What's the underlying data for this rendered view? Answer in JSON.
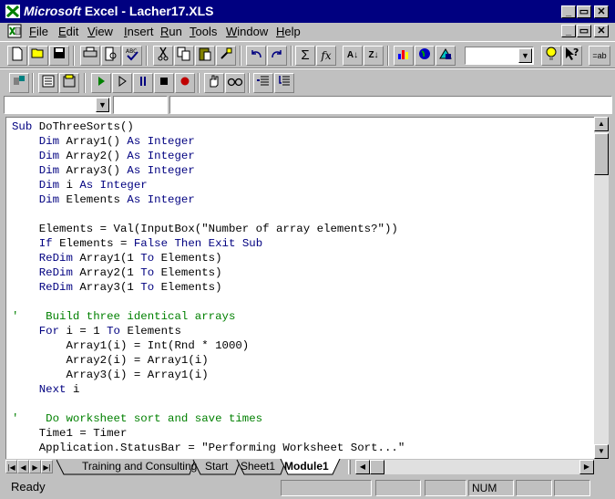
{
  "window": {
    "title_brand": "Microsoft",
    "title_rest": " Excel - Lacher17.XLS",
    "buttons": {
      "minimize": "_",
      "restore": "▭",
      "close": "✕"
    },
    "doc_buttons": {
      "minimize": "_",
      "restore": "▭",
      "close": "✕"
    }
  },
  "menubar": {
    "items": [
      {
        "pre": "",
        "ul": "F",
        "post": "ile"
      },
      {
        "pre": "",
        "ul": "E",
        "post": "dit"
      },
      {
        "pre": "",
        "ul": "V",
        "post": "iew"
      },
      {
        "pre": "",
        "ul": "I",
        "post": "nsert"
      },
      {
        "pre": "",
        "ul": "R",
        "post": "un"
      },
      {
        "pre": "",
        "ul": "T",
        "post": "ools"
      },
      {
        "pre": "",
        "ul": "W",
        "post": "indow"
      },
      {
        "pre": "",
        "ul": "H",
        "post": "elp"
      }
    ]
  },
  "toolbar": {
    "sum": "Σ",
    "fx": "fx",
    "sort_asc": "A↓",
    "sort_desc": "Z↓",
    "label_ab": "ab"
  },
  "code": {
    "lines": [
      [
        [
          "kw",
          "Sub "
        ],
        [
          "",
          "DoThreeSorts()"
        ]
      ],
      [
        [
          "",
          "    "
        ],
        [
          "kw",
          "Dim "
        ],
        [
          "",
          "Array1() "
        ],
        [
          "kw",
          "As Integer"
        ]
      ],
      [
        [
          "",
          "    "
        ],
        [
          "kw",
          "Dim "
        ],
        [
          "",
          "Array2() "
        ],
        [
          "kw",
          "As Integer"
        ]
      ],
      [
        [
          "",
          "    "
        ],
        [
          "kw",
          "Dim "
        ],
        [
          "",
          "Array3() "
        ],
        [
          "kw",
          "As Integer"
        ]
      ],
      [
        [
          "",
          "    "
        ],
        [
          "kw",
          "Dim "
        ],
        [
          "",
          "i "
        ],
        [
          "kw",
          "As Integer"
        ]
      ],
      [
        [
          "",
          "    "
        ],
        [
          "kw",
          "Dim "
        ],
        [
          "",
          "Elements "
        ],
        [
          "kw",
          "As Integer"
        ]
      ],
      [
        [
          "",
          ""
        ]
      ],
      [
        [
          "",
          "    Elements = Val(InputBox(\"Number of array elements?\"))"
        ]
      ],
      [
        [
          "",
          "    "
        ],
        [
          "kw",
          "If "
        ],
        [
          "",
          "Elements = "
        ],
        [
          "kw",
          "False Then Exit Sub"
        ]
      ],
      [
        [
          "",
          "    "
        ],
        [
          "kw",
          "ReDim "
        ],
        [
          "",
          "Array1(1 "
        ],
        [
          "kw",
          "To "
        ],
        [
          "",
          "Elements)"
        ]
      ],
      [
        [
          "",
          "    "
        ],
        [
          "kw",
          "ReDim "
        ],
        [
          "",
          "Array2(1 "
        ],
        [
          "kw",
          "To "
        ],
        [
          "",
          "Elements)"
        ]
      ],
      [
        [
          "",
          "    "
        ],
        [
          "kw",
          "ReDim "
        ],
        [
          "",
          "Array3(1 "
        ],
        [
          "kw",
          "To "
        ],
        [
          "",
          "Elements)"
        ]
      ],
      [
        [
          "",
          ""
        ]
      ],
      [
        [
          "cm",
          "'    Build three identical arrays"
        ]
      ],
      [
        [
          "",
          "    "
        ],
        [
          "kw",
          "For "
        ],
        [
          "",
          "i = 1 "
        ],
        [
          "kw",
          "To "
        ],
        [
          "",
          "Elements"
        ]
      ],
      [
        [
          "",
          "        Array1(i) = Int(Rnd * 1000)"
        ]
      ],
      [
        [
          "",
          "        Array2(i) = Array1(i)"
        ]
      ],
      [
        [
          "",
          "        Array3(i) = Array1(i)"
        ]
      ],
      [
        [
          "",
          "    "
        ],
        [
          "kw",
          "Next "
        ],
        [
          "",
          "i"
        ]
      ],
      [
        [
          "",
          ""
        ]
      ],
      [
        [
          "cm",
          "'    Do worksheet sort and save times"
        ]
      ],
      [
        [
          "",
          "    Time1 = Timer"
        ]
      ],
      [
        [
          "",
          "    Application.StatusBar = \"Performing Worksheet Sort...\""
        ]
      ]
    ]
  },
  "tabs": {
    "nav": [
      "|◀",
      "◀",
      "▶",
      "▶|"
    ],
    "items": [
      {
        "label": "Training and Consulting",
        "active": false
      },
      {
        "label": "Start",
        "active": false
      },
      {
        "label": "Sheet1",
        "active": false
      },
      {
        "label": "Module1",
        "active": true
      }
    ]
  },
  "status": {
    "ready": "Ready",
    "num": "NUM"
  },
  "colors": {
    "title_bg": "#000080",
    "keyword": "#000080",
    "comment": "#008000",
    "chrome": "#c0c0c0"
  }
}
